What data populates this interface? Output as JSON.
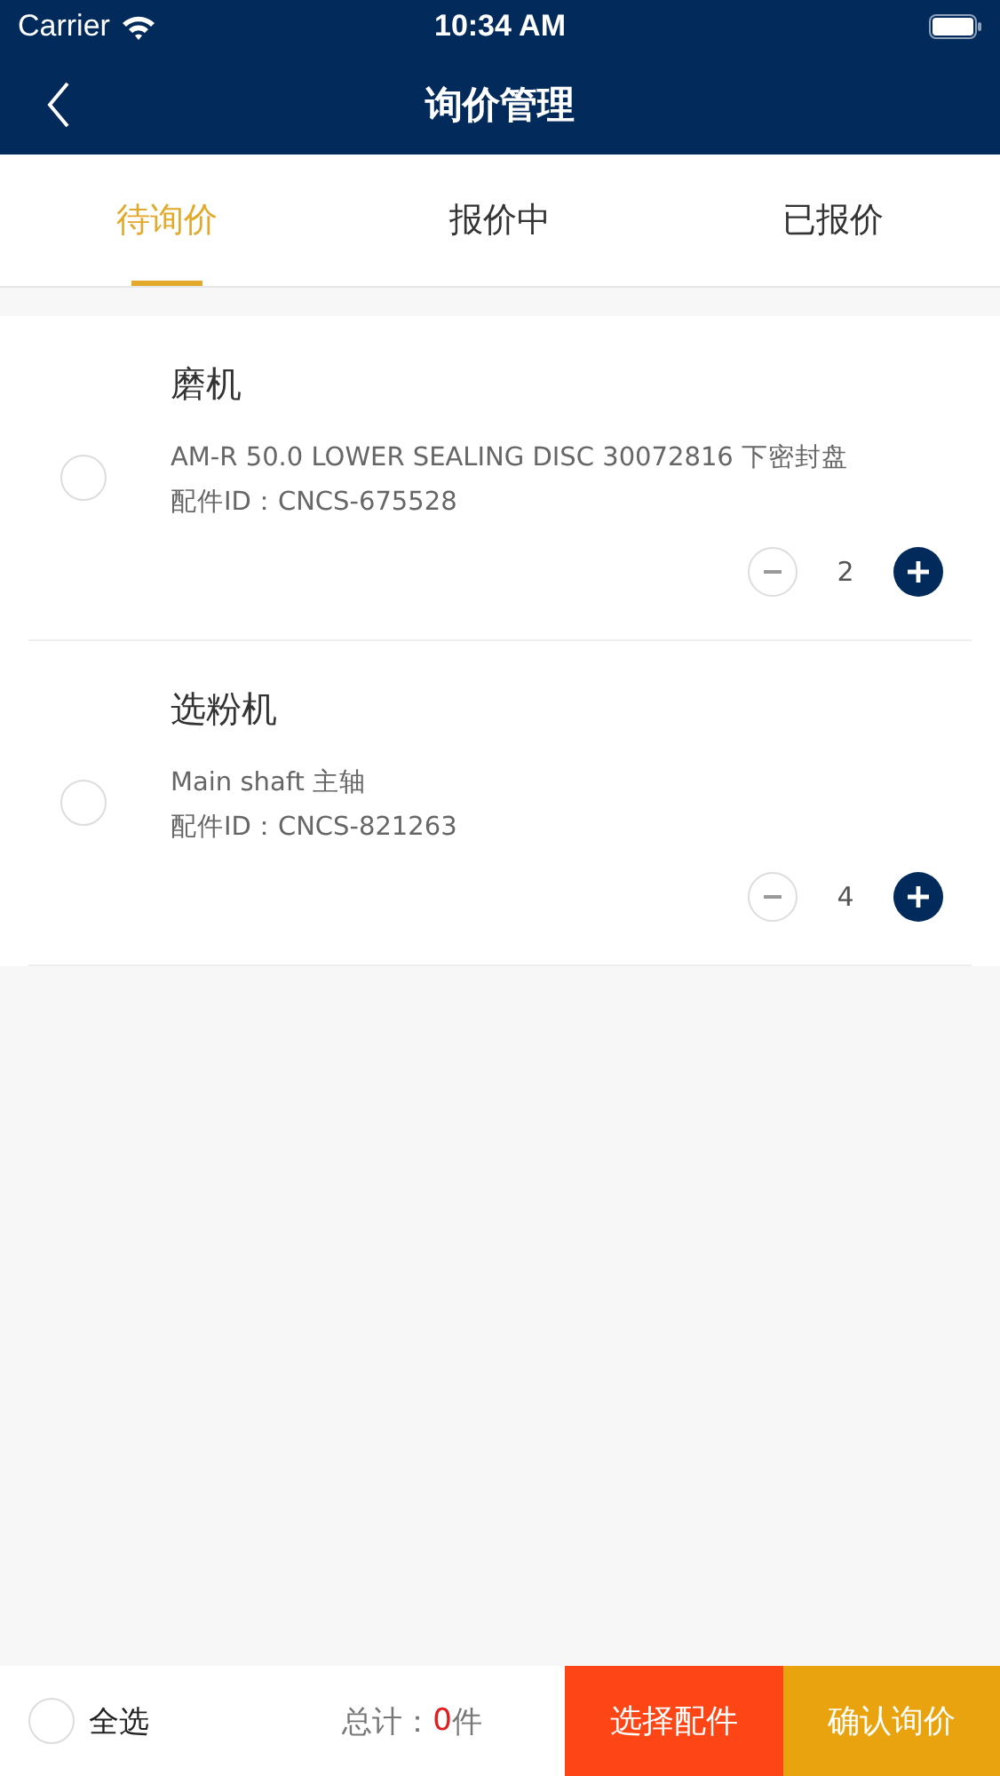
{
  "status_bar": {
    "carrier": "Carrier",
    "time": "10:34 AM"
  },
  "nav": {
    "title": "询价管理"
  },
  "tabs": [
    {
      "label": "待询价",
      "selected": true
    },
    {
      "label": "报价中",
      "selected": false
    },
    {
      "label": "已报价",
      "selected": false
    }
  ],
  "items": [
    {
      "machine": "磨机",
      "part": "AM-R 50.0 LOWER SEALING DISC 30072816 下密封盘",
      "part_id": "配件ID：CNCS-675528",
      "quantity": "2",
      "checked": false
    },
    {
      "machine": "选粉机",
      "part": "Main shaft 主轴",
      "part_id": "配件ID：CNCS-821263",
      "quantity": "4",
      "checked": false
    }
  ],
  "footer": {
    "select_all": {
      "label": "全选",
      "checked": false
    },
    "total_label": "总计：",
    "total_count": "0",
    "total_unit": "件",
    "buttons": [
      "选择配件",
      "确认询价"
    ]
  }
}
